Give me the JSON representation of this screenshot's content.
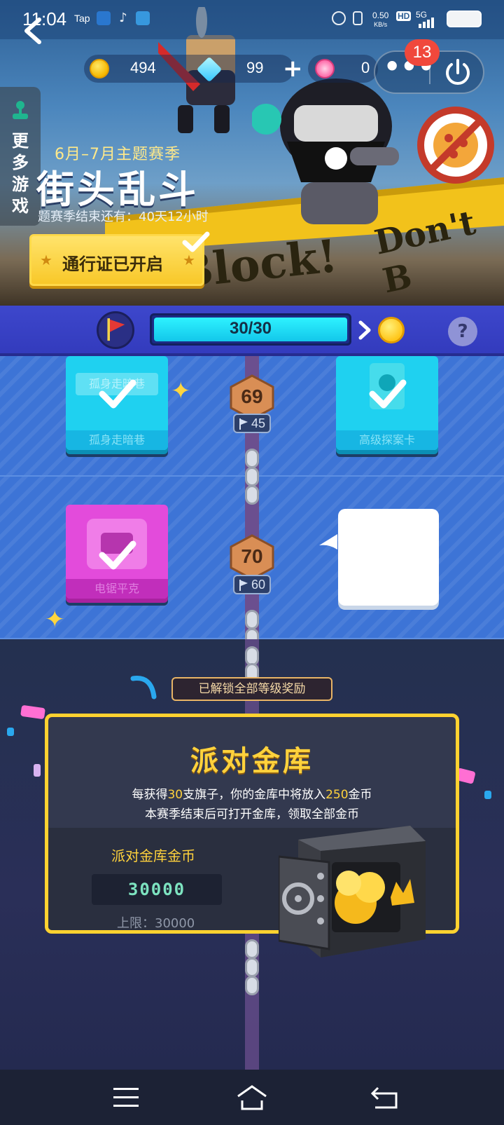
{
  "status_bar": {
    "time": "11:04",
    "app_label": "Tap",
    "speed": "0.50",
    "speed_unit": "KB/s",
    "hd": "HD",
    "net": "5G"
  },
  "resources": {
    "coins": "494",
    "gems": "99",
    "plus": "+",
    "tokens": "0"
  },
  "top_menu": {
    "more": "•••",
    "badge_count": "13"
  },
  "side_panel": {
    "more_games": "更多游戏"
  },
  "season": {
    "subtitle": "6月–7月主题赛季",
    "title": "街头乱斗",
    "countdown": "题赛季结束还有：40天12小时",
    "pass_button": "通行证已开启"
  },
  "banner_art": {
    "tape_text_1": "Block!",
    "tape_text_2": "Don't B"
  },
  "progress": {
    "text": "30/30",
    "value": 1.0,
    "help": "?"
  },
  "levels": [
    {
      "level": "69",
      "flags": "45"
    },
    {
      "level": "70",
      "flags": "60"
    }
  ],
  "rewards": {
    "row1_left_tag": "孤身走暗巷",
    "row1_left_label": "孤身走暗巷",
    "row1_right_label": "高级探案卡",
    "row2_left_label": "电锯平克"
  },
  "vault": {
    "unlocked_tag": "已解锁全部等级奖励",
    "title": "派对金库",
    "desc1_pre": "每获得",
    "desc1_num1": "30",
    "desc1_mid": "支旗子，你的金库中将放入",
    "desc1_num2": "250",
    "desc1_post": "金币",
    "desc2": "本赛季结束后可打开金库，领取全部金币",
    "coin_label": "派对金库金币",
    "coin_value": "30000",
    "limit": "上限：30000"
  },
  "colors": {
    "accent": "#ffd23c",
    "progress": "#1fdcf5",
    "card_cyan": "#1fd1f0",
    "card_pink": "#e34bdb"
  }
}
